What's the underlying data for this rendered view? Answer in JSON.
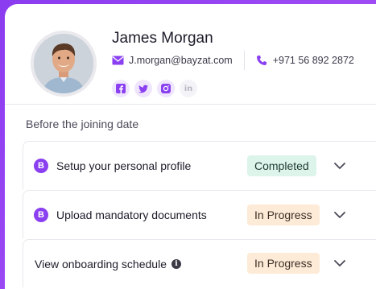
{
  "profile": {
    "name": "James Morgan",
    "email": "J.morgan@bayzat.com",
    "phone": "+971 56 892 2872",
    "socials": [
      "facebook-icon",
      "twitter-icon",
      "instagram-icon",
      "linkedin-icon"
    ]
  },
  "section": {
    "title": "Before the joining date"
  },
  "tasks": [
    {
      "label": "Setup your personal profile",
      "status": "Completed",
      "status_type": "done",
      "icon_letter": "B"
    },
    {
      "label": "Upload mandatory documents",
      "status": "In Progress",
      "status_type": "progress",
      "icon_letter": "B"
    },
    {
      "label": "View onboarding schedule",
      "status": "In Progress",
      "status_type": "progress",
      "info_icon": "i"
    }
  ],
  "colors": {
    "accent": "#8a3ff0",
    "completed_bg": "#dcf4ea",
    "progress_bg": "#fdebd7"
  }
}
